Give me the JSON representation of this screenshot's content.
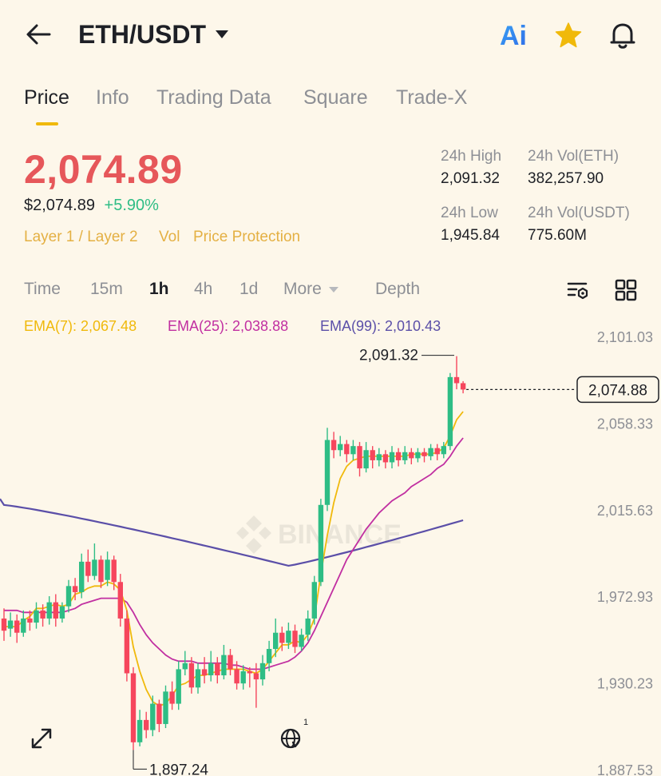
{
  "header": {
    "pair": "ETH/USDT",
    "icons": [
      "back-arrow-icon",
      "chevron-down-icon",
      "ai-icon",
      "star-icon",
      "bell-icon"
    ],
    "ai_label": "Ai"
  },
  "tabs": [
    {
      "label": "Price",
      "active": true
    },
    {
      "label": "Info"
    },
    {
      "label": "Trading Data"
    },
    {
      "label": "Square"
    },
    {
      "label": "Trade-X"
    }
  ],
  "ticker": {
    "last_price": "2,074.89",
    "usd_price": "$2,074.89",
    "change": "+5.90%",
    "tags": [
      "Layer 1 / Layer 2",
      "Vol",
      "Price Protection"
    ],
    "high_label": "24h High",
    "high": "2,091.32",
    "low_label": "24h Low",
    "low": "1,945.84",
    "vol_base_label": "24h Vol(ETH)",
    "vol_base": "382,257.90",
    "vol_quote_label": "24h Vol(USDT)",
    "vol_quote": "775.60M"
  },
  "timeframes": {
    "items": [
      "Time",
      "15m",
      "1h",
      "4h",
      "1d",
      "More",
      "Depth"
    ],
    "selected": "1h"
  },
  "ema": {
    "ema7": "EMA(7): 2,067.48",
    "ema25": "EMA(25): 2,038.88",
    "ema99": "EMA(99): 2,010.43"
  },
  "colors": {
    "up": "#2ebd85",
    "down": "#f6465d",
    "ema7": "#f0b90b",
    "ema25": "#c12fa1",
    "ema99": "#5b4fa8",
    "price_red": "#e6575a",
    "change_green": "#2ebd85",
    "tag_gold": "#e4b043"
  },
  "chart": {
    "watermark": "BINANCE",
    "high_marker": "2,091.32",
    "low_marker": "1,897.24",
    "current_price_tag": "2,074.88",
    "globe_badge": "1"
  },
  "chart_data": {
    "type": "candlestick",
    "y_ticks": [
      "2,101.03",
      "2,058.33",
      "2,015.63",
      "1,972.93",
      "1,930.23",
      "1,887.53"
    ],
    "ylim": [
      1887.53,
      2101.03
    ],
    "candles": [
      [
        1962,
        1956,
        1967,
        1951
      ],
      [
        1957,
        1961,
        1965,
        1953
      ],
      [
        1961,
        1955,
        1964,
        1950
      ],
      [
        1955,
        1962,
        1966,
        1953
      ],
      [
        1962,
        1960,
        1966,
        1956
      ],
      [
        1960,
        1966,
        1970,
        1957
      ],
      [
        1966,
        1962,
        1969,
        1958
      ],
      [
        1962,
        1970,
        1973,
        1959
      ],
      [
        1970,
        1962,
        1974,
        1958
      ],
      [
        1962,
        1968,
        1970,
        1960
      ],
      [
        1968,
        1978,
        1981,
        1965
      ],
      [
        1978,
        1975,
        1982,
        1971
      ],
      [
        1975,
        1990,
        1994,
        1972
      ],
      [
        1990,
        1983,
        1996,
        1980
      ],
      [
        1983,
        1991,
        1999,
        1981
      ],
      [
        1991,
        1980,
        1993,
        1977
      ],
      [
        1981,
        1991,
        1995,
        1978
      ],
      [
        1991,
        1980,
        1993,
        1976
      ],
      [
        1980,
        1962,
        1984,
        1958
      ],
      [
        1962,
        1935,
        1966,
        1931
      ],
      [
        1935,
        1901,
        1938,
        1897.24
      ],
      [
        1901,
        1912,
        1917,
        1899
      ],
      [
        1912,
        1907,
        1916,
        1903
      ],
      [
        1907,
        1920,
        1924,
        1904
      ],
      [
        1920,
        1910,
        1922,
        1906
      ],
      [
        1910,
        1926,
        1929,
        1908
      ],
      [
        1926,
        1920,
        1931,
        1917
      ],
      [
        1920,
        1937,
        1941,
        1917
      ],
      [
        1937,
        1940,
        1946,
        1934
      ],
      [
        1940,
        1928,
        1943,
        1925
      ],
      [
        1928,
        1937,
        1940,
        1925
      ],
      [
        1937,
        1934,
        1943,
        1930
      ],
      [
        1934,
        1940,
        1946,
        1931
      ],
      [
        1940,
        1934,
        1943,
        1930
      ],
      [
        1934,
        1944,
        1949,
        1932
      ],
      [
        1944,
        1937,
        1947,
        1934
      ],
      [
        1937,
        1930,
        1941,
        1927
      ],
      [
        1930,
        1936,
        1939,
        1927
      ],
      [
        1936,
        1935,
        1938,
        1928
      ],
      [
        1935,
        1932,
        1940,
        1918
      ],
      [
        1932,
        1940,
        1944,
        1929
      ],
      [
        1940,
        1947,
        1951,
        1936
      ],
      [
        1947,
        1955,
        1962,
        1943
      ],
      [
        1955,
        1950,
        1958,
        1946
      ],
      [
        1950,
        1956,
        1960,
        1947
      ],
      [
        1956,
        1948,
        1959,
        1945
      ],
      [
        1948,
        1954,
        1957,
        1946
      ],
      [
        1954,
        1962,
        1966,
        1951
      ],
      [
        1962,
        1980,
        1983,
        1959
      ],
      [
        1980,
        2018,
        2021,
        1978
      ],
      [
        2018,
        2050,
        2056,
        2015
      ],
      [
        2050,
        2045,
        2054,
        2041
      ],
      [
        2045,
        2048,
        2052,
        2042
      ],
      [
        2048,
        2043,
        2050,
        2039
      ],
      [
        2043,
        2047,
        2050,
        2040
      ],
      [
        2047,
        2036,
        2049,
        2032
      ],
      [
        2036,
        2045,
        2049,
        2034
      ],
      [
        2045,
        2040,
        2047,
        2036
      ],
      [
        2040,
        2043,
        2046,
        2037
      ],
      [
        2043,
        2039,
        2045,
        2036
      ],
      [
        2039,
        2044,
        2047,
        2036
      ],
      [
        2044,
        2040,
        2046,
        2037
      ],
      [
        2040,
        2044,
        2047,
        2038
      ],
      [
        2044,
        2041,
        2046,
        2038
      ],
      [
        2041,
        2044,
        2046,
        2039
      ],
      [
        2044,
        2042,
        2046,
        2039
      ],
      [
        2042,
        2046,
        2048,
        2040
      ],
      [
        2046,
        2043,
        2048,
        2040
      ],
      [
        2043,
        2047,
        2049,
        2041
      ],
      [
        2047,
        2081,
        2083,
        2045
      ],
      [
        2081,
        2078,
        2091.32,
        2075
      ],
      [
        2078,
        2074.88,
        2079,
        2073
      ]
    ],
    "ema7": [
      1958,
      1958,
      1958,
      1961,
      1963,
      1967,
      1967,
      1968,
      1969,
      1968,
      1969,
      1974,
      1975,
      1977,
      1978,
      1978,
      1980,
      1979,
      1976,
      1966,
      1948,
      1936,
      1927,
      1921,
      1919,
      1920,
      1924,
      1929,
      1930,
      1932,
      1934,
      1934,
      1935,
      1936,
      1937,
      1937,
      1937,
      1937,
      1936,
      1935,
      1937,
      1941,
      1945,
      1949,
      1949,
      1951,
      1950,
      1954,
      1962,
      1984,
      2003,
      2019,
      2031,
      2037,
      2040,
      2041,
      2042,
      2042,
      2042,
      2042,
      2042,
      2042,
      2042,
      2043,
      2043,
      2043,
      2043,
      2044,
      2046,
      2052,
      2060,
      2064
    ],
    "ema25": [
      1966,
      1966,
      1966,
      1965,
      1965,
      1965,
      1965,
      1965,
      1965,
      1965,
      1966,
      1967,
      1969,
      1970,
      1971,
      1972,
      1972,
      1972,
      1972,
      1970,
      1965,
      1959,
      1954,
      1950,
      1947,
      1944,
      1942,
      1941,
      1941,
      1941,
      1940,
      1940,
      1940,
      1940,
      1940,
      1939,
      1939,
      1938,
      1937,
      1937,
      1937,
      1938,
      1939,
      1940,
      1941,
      1943,
      1946,
      1950,
      1956,
      1963,
      1970,
      1977,
      1984,
      1991,
      1996,
      2001,
      2006,
      2010,
      2014,
      2017,
      2020,
      2022,
      2024,
      2027,
      2029,
      2031,
      2033,
      2036,
      2038,
      2042,
      2047,
      2051
    ]
  }
}
